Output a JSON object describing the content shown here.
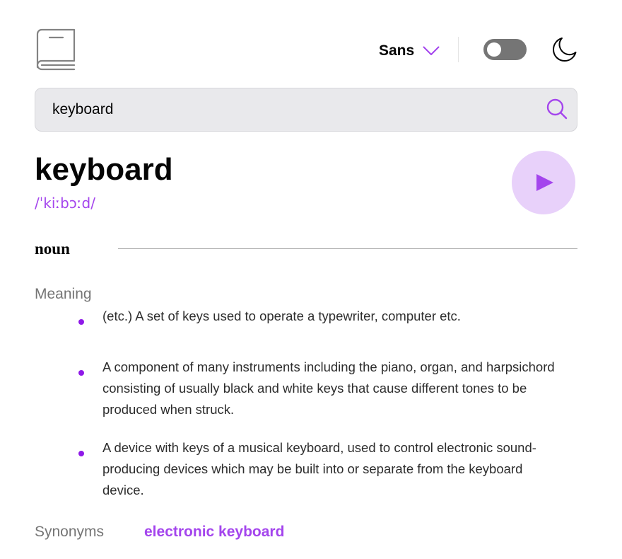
{
  "header": {
    "logo_icon": "book-icon",
    "font_selector": {
      "selected": "Sans",
      "icon": "chevron-down-icon"
    },
    "theme_toggle": {
      "state": "off"
    },
    "theme_icon": "moon-icon"
  },
  "search": {
    "value": "keyboard",
    "icon": "search-icon"
  },
  "entry": {
    "word": "keyboard",
    "phonetic": "/ˈkiːbɔːd/",
    "play_icon": "play-icon",
    "part_of_speech": "noun",
    "meaning_label": "Meaning",
    "definitions": [
      "(etc.) A set of keys used to operate a typewriter, computer etc.",
      "A component of many instruments including the piano, organ, and harpsichord consisting of usually black and white keys that cause different tones to be produced when struck.",
      "A device with keys of a musical keyboard, used to control electronic sound-producing devices which may be built into or separate from the keyboard device."
    ],
    "synonyms_label": "Synonyms",
    "synonyms": [
      "electronic keyboard"
    ]
  },
  "colors": {
    "accent": "#a445ed",
    "accent_light": "#e8d1fa",
    "bullet": "#8f19e8",
    "muted": "#757575",
    "search_bg": "#e9e9ec"
  }
}
